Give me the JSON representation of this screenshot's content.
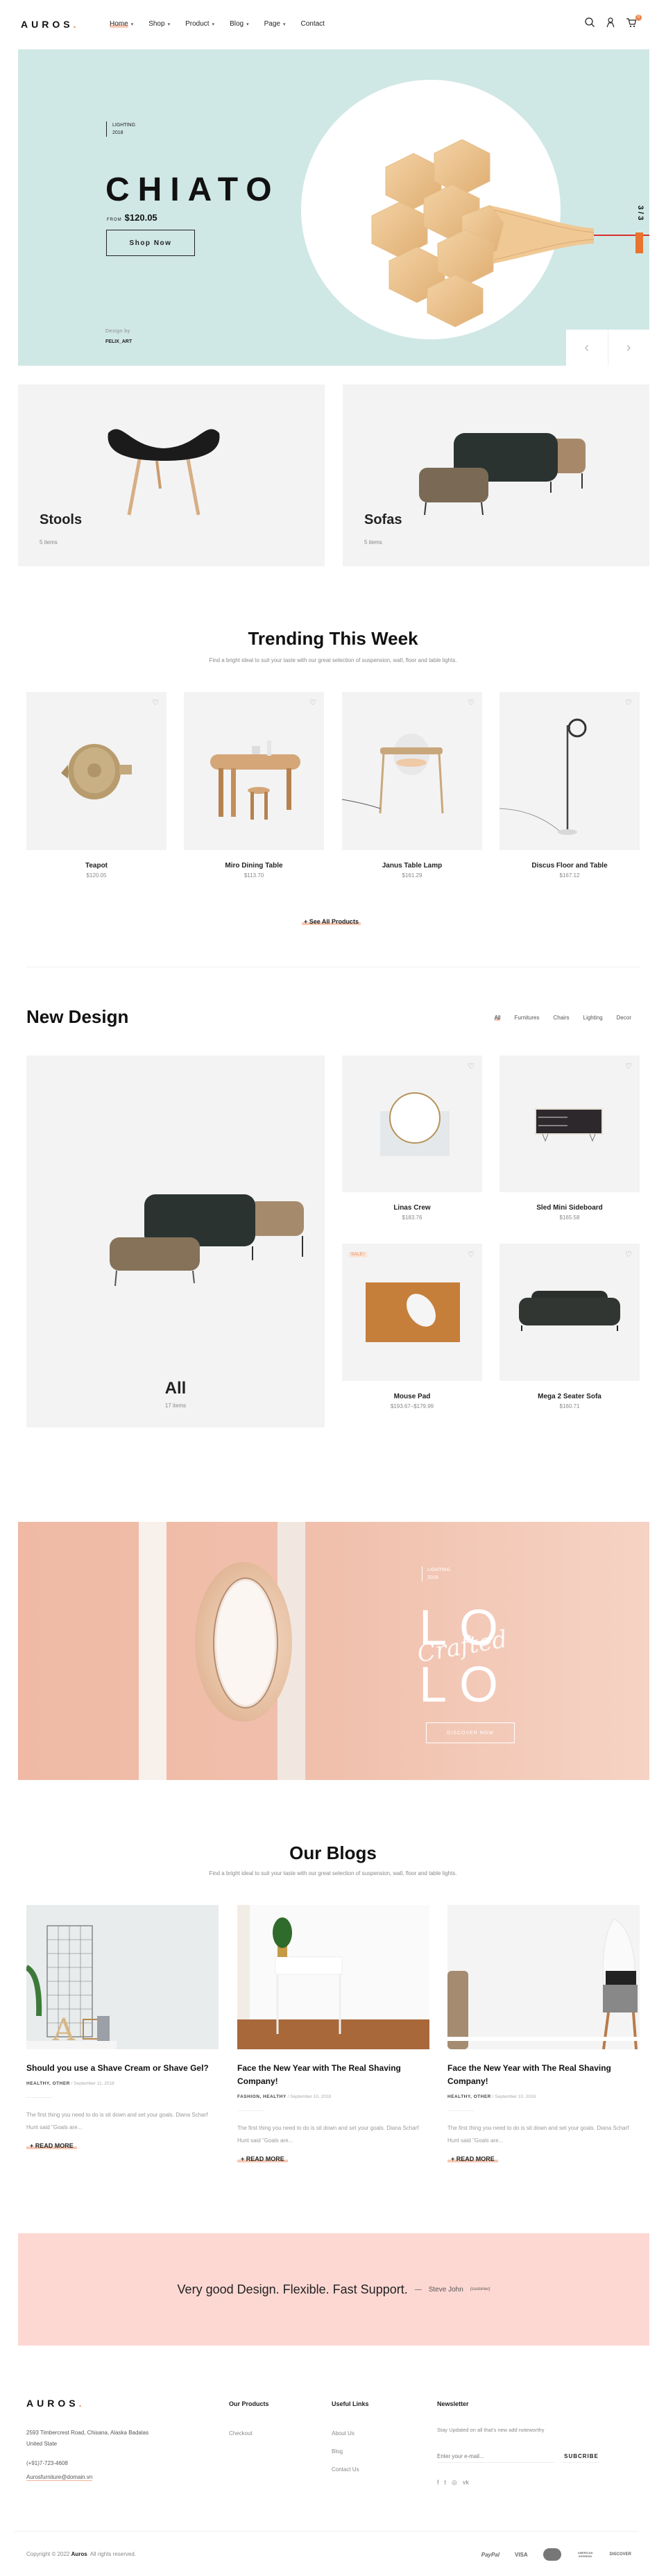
{
  "header": {
    "logo": "AUROS",
    "logo_dot": ".",
    "nav": [
      {
        "label": "Home",
        "has_dropdown": true,
        "active": true
      },
      {
        "label": "Shop",
        "has_dropdown": true
      },
      {
        "label": "Product",
        "has_dropdown": true
      },
      {
        "label": "Blog",
        "has_dropdown": true
      },
      {
        "label": "Page",
        "has_dropdown": true
      },
      {
        "label": "Contact",
        "has_dropdown": false
      }
    ],
    "icons": [
      "search-icon",
      "user-icon",
      "cart-icon"
    ],
    "cart_count": "0"
  },
  "hero": {
    "category": "LIGHTING",
    "year": "2018",
    "title": "CHIATO",
    "price_prefix": "FROM",
    "price": "$120.05",
    "button": "Shop Now",
    "design_by_label": "Design by",
    "designer": "FELIX_ART",
    "slide_counter": "3 / 3",
    "prev_icon": "‹",
    "next_icon": "›",
    "colors": {
      "background": "#d0e8e5",
      "accent": "#e8742e"
    }
  },
  "categories": [
    {
      "name": "Stools",
      "count": "5 items"
    },
    {
      "name": "Sofas",
      "count": "5 items"
    }
  ],
  "trending": {
    "title": "Trending This Week",
    "subtitle": "Find a bright ideal to suit your taste with our great selection of suspension, wall, floor and table lights.",
    "products": [
      {
        "name": "Teapot",
        "price": "$120.05"
      },
      {
        "name": "Miro Dining Table",
        "price": "$113.70"
      },
      {
        "name": "Janus Table Lamp",
        "price": "$161.29"
      },
      {
        "name": "Discus Floor and Table",
        "price": "$167.12"
      }
    ],
    "see_all": "+ See All Products"
  },
  "new_design": {
    "title": "New Design",
    "tabs": [
      {
        "label": "All",
        "active": true
      },
      {
        "label": "Furnitures"
      },
      {
        "label": "Chairs"
      },
      {
        "label": "Lighting"
      },
      {
        "label": "Decor"
      }
    ],
    "feature": {
      "name": "All",
      "count": "17 items"
    },
    "products": [
      {
        "name": "Linas Crew",
        "price": "$183.76"
      },
      {
        "name": "Sled Mini Sideboard",
        "price": "$165.58"
      },
      {
        "name": "Mouse Pad",
        "price": "$193.67–$179.99",
        "badge": "SALE!"
      },
      {
        "name": "Mega 2 Seater Sofa",
        "price": "$160.71"
      }
    ]
  },
  "banner": {
    "category": "LIGHTING",
    "year": "2018",
    "line1": "LO",
    "line2": "LO",
    "script": "Crafted",
    "button": "DISCOVER NOW"
  },
  "blogs": {
    "title": "Our Blogs",
    "subtitle": "Find a bright ideal to suit your taste with our great selection of suspension, wall, floor and table lights.",
    "posts": [
      {
        "title": "Should you use a Shave Cream or Shave Gel?",
        "tags": "HEALTHY, OTHER",
        "date": "September 11, 2018",
        "excerpt": "The first thing you need to do is sit down and set your goals. Diana Scharf Hunt said \"Goals are...",
        "more": "+ READ MORE"
      },
      {
        "title": "Face the New Year with The Real Shaving Company!",
        "tags": "FASHION, HEALTHY",
        "date": "September 10, 2018",
        "excerpt": "The first thing you need to do is sit down and set your goals. Diana Scharf Hunt said \"Goals are...",
        "more": "+ READ MORE"
      },
      {
        "title": "Face the New Year with The Real Shaving Company!",
        "tags": "HEALTHY, OTHER",
        "date": "September 10, 2018",
        "excerpt": "The first thing you need to do is sit down and set your goals. Diana Scharf Hunt said \"Goals are...",
        "more": "+ READ MORE"
      }
    ]
  },
  "testimonial": {
    "quote": "Very good Design. Flexible. Fast Support.",
    "dash": "—",
    "author": "Steve John",
    "role": "(customer)"
  },
  "footer": {
    "logo": "AUROS",
    "address_line1": "2593 Timbercrest Road, Chisana, Alaska Badalas",
    "address_line2": "United State",
    "phone": "(+91)7-723-4608",
    "email": "Aurosfurniture@domain.vn",
    "products_title": "Our Products",
    "products_links": [
      "Checkout"
    ],
    "useful_title": "Useful Links",
    "useful_links": [
      "About Us",
      "Blog",
      "Contact Us"
    ],
    "newsletter_title": "Newsletter",
    "newsletter_text": "Stay Updated on all that's new add noteworthy",
    "newsletter_placeholder": "Enter your e-mail...",
    "subscribe": "SUBCRIBE",
    "social": [
      "f",
      "t",
      "◎",
      "vk"
    ],
    "copyright_pre": "Copyright © 2022 ",
    "copyright_brand": "Auros",
    "copyright_post": ". All rights reserved.",
    "payments": [
      "PayPal",
      "VISA",
      "MasterCard",
      "AMERICAN EXPRESS",
      "DISCOVER"
    ]
  }
}
